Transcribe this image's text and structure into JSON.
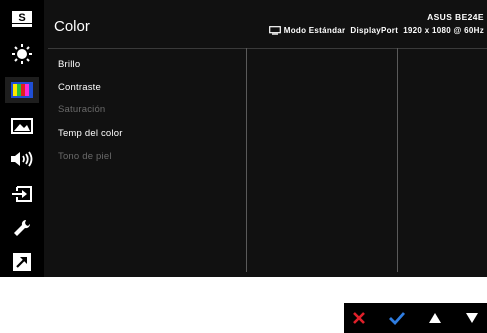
{
  "window": {
    "title": "Color",
    "model": "ASUS BE24E",
    "mode": "Modo Estándar",
    "input": "DisplayPort",
    "resolution": "1920 x 1080 @ 60Hz"
  },
  "sidebar": {
    "items": [
      {
        "name": "splendid",
        "icon": "s-icon"
      },
      {
        "name": "blue-light-filter",
        "icon": "brightness-sun-icon"
      },
      {
        "name": "color",
        "icon": "color-bars-icon",
        "active": true
      },
      {
        "name": "image",
        "icon": "picture-icon"
      },
      {
        "name": "sound",
        "icon": "speaker-icon"
      },
      {
        "name": "input-select",
        "icon": "input-icon"
      },
      {
        "name": "system-setup",
        "icon": "wrench-icon"
      },
      {
        "name": "shortcut",
        "icon": "shortcut-arrow-icon"
      }
    ]
  },
  "menu": {
    "items": [
      {
        "label": "Brillo",
        "enabled": true
      },
      {
        "label": "Contraste",
        "enabled": true
      },
      {
        "label": "Saturación",
        "enabled": false
      },
      {
        "label": "Temp del color",
        "enabled": true
      },
      {
        "label": "Tono de piel",
        "enabled": false
      }
    ]
  },
  "buttons": [
    {
      "name": "close",
      "icon": "close-x-icon",
      "color": "#e0202a"
    },
    {
      "name": "confirm",
      "icon": "check-icon",
      "color": "#2f7de1"
    },
    {
      "name": "up",
      "icon": "triangle-up-icon",
      "color": "#ffffff"
    },
    {
      "name": "down",
      "icon": "triangle-down-icon",
      "color": "#ffffff"
    }
  ]
}
